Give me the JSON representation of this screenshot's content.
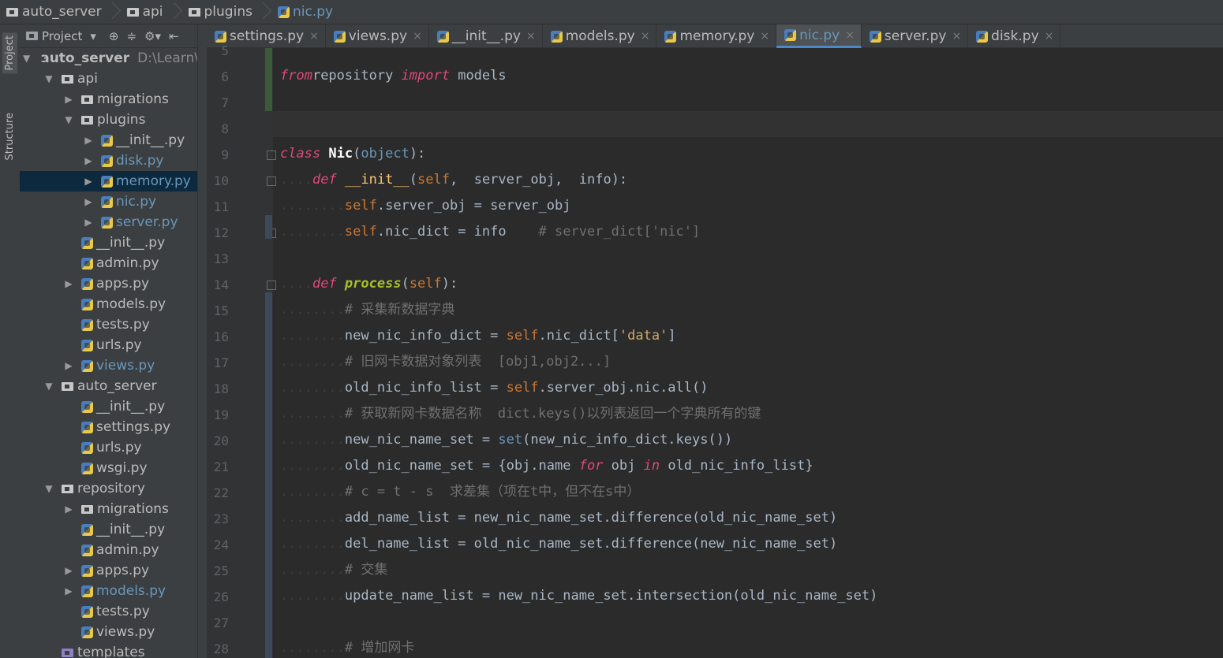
{
  "breadcrumb": [
    "auto_server",
    "api",
    "plugins",
    "nic.py"
  ],
  "project_panel": {
    "title": "Project",
    "tree": [
      {
        "depth": 0,
        "arrow": "▼",
        "type": "folder",
        "label": "auto_server",
        "path": "D:\\Learn\\P",
        "bold": true
      },
      {
        "depth": 1,
        "arrow": "▼",
        "type": "folder",
        "label": "api"
      },
      {
        "depth": 2,
        "arrow": "▶",
        "type": "folder",
        "label": "migrations"
      },
      {
        "depth": 2,
        "arrow": "▼",
        "type": "folder",
        "label": "plugins"
      },
      {
        "depth": 3,
        "arrow": "▶",
        "type": "py",
        "label": "__init__.py"
      },
      {
        "depth": 3,
        "arrow": "▶",
        "type": "py",
        "label": "disk.py",
        "blue": true
      },
      {
        "depth": 3,
        "arrow": "▶",
        "type": "py",
        "label": "memory.py",
        "blue": true,
        "selected": true
      },
      {
        "depth": 3,
        "arrow": "▶",
        "type": "py",
        "label": "nic.py",
        "blue": true
      },
      {
        "depth": 3,
        "arrow": "▶",
        "type": "py",
        "label": "server.py",
        "blue": true
      },
      {
        "depth": 2,
        "arrow": "",
        "type": "py",
        "label": "__init__.py"
      },
      {
        "depth": 2,
        "arrow": "",
        "type": "py",
        "label": "admin.py"
      },
      {
        "depth": 2,
        "arrow": "▶",
        "type": "py",
        "label": "apps.py"
      },
      {
        "depth": 2,
        "arrow": "",
        "type": "py",
        "label": "models.py"
      },
      {
        "depth": 2,
        "arrow": "",
        "type": "py",
        "label": "tests.py"
      },
      {
        "depth": 2,
        "arrow": "",
        "type": "py",
        "label": "urls.py"
      },
      {
        "depth": 2,
        "arrow": "▶",
        "type": "py",
        "label": "views.py",
        "blue": true
      },
      {
        "depth": 1,
        "arrow": "▼",
        "type": "folder",
        "label": "auto_server"
      },
      {
        "depth": 2,
        "arrow": "",
        "type": "py",
        "label": "__init__.py"
      },
      {
        "depth": 2,
        "arrow": "",
        "type": "py",
        "label": "settings.py"
      },
      {
        "depth": 2,
        "arrow": "",
        "type": "py",
        "label": "urls.py"
      },
      {
        "depth": 2,
        "arrow": "",
        "type": "py",
        "label": "wsgi.py"
      },
      {
        "depth": 1,
        "arrow": "▼",
        "type": "folder",
        "label": "repository"
      },
      {
        "depth": 2,
        "arrow": "▶",
        "type": "folder",
        "label": "migrations"
      },
      {
        "depth": 2,
        "arrow": "",
        "type": "py",
        "label": "__init__.py"
      },
      {
        "depth": 2,
        "arrow": "",
        "type": "py",
        "label": "admin.py"
      },
      {
        "depth": 2,
        "arrow": "▶",
        "type": "py",
        "label": "apps.py"
      },
      {
        "depth": 2,
        "arrow": "▶",
        "type": "py",
        "label": "models.py",
        "blue": true
      },
      {
        "depth": 2,
        "arrow": "",
        "type": "py",
        "label": "tests.py"
      },
      {
        "depth": 2,
        "arrow": "",
        "type": "py",
        "label": "views.py"
      },
      {
        "depth": 1,
        "arrow": "",
        "type": "folder",
        "label": "templates"
      }
    ]
  },
  "side_tabs": [
    "Project",
    "Structure"
  ],
  "tabs": [
    {
      "label": "settings.py"
    },
    {
      "label": "views.py"
    },
    {
      "label": "__init__.py"
    },
    {
      "label": "models.py"
    },
    {
      "label": "memory.py"
    },
    {
      "label": "nic.py",
      "active": true
    },
    {
      "label": "server.py"
    },
    {
      "label": "disk.py"
    }
  ],
  "line_numbers": [
    "5",
    "6",
    "7",
    "8",
    "9",
    "10",
    "11",
    "12",
    "13",
    "14",
    "15",
    "16",
    "17",
    "18",
    "19",
    "20",
    "21",
    "22",
    "23",
    "24",
    "25",
    "26",
    "27",
    "28"
  ],
  "code_lines": [
    [],
    [
      [
        "kwp",
        "from"
      ],
      [
        "",
        "repository "
      ],
      [
        "kwp",
        "import"
      ],
      [
        "",
        " models"
      ]
    ],
    [],
    [],
    [
      [
        "kwp",
        "class "
      ],
      [
        "cls",
        "Nic"
      ],
      [
        "",
        "("
      ],
      [
        "builtin",
        "object"
      ],
      [
        "",
        "):"
      ]
    ],
    [
      [
        "dots",
        "...."
      ],
      [
        "kwp",
        "def "
      ],
      [
        "fn",
        "__init__"
      ],
      [
        "",
        "("
      ],
      [
        "self",
        "self"
      ],
      [
        "",
        ",  server_obj,  info):"
      ]
    ],
    [
      [
        "dots",
        "........"
      ],
      [
        "self",
        "self"
      ],
      [
        "",
        ".server_obj = server_obj"
      ]
    ],
    [
      [
        "dots",
        "........"
      ],
      [
        "self",
        "self"
      ],
      [
        "",
        ".nic_dict = info  "
      ],
      [
        "cmt",
        "  # server_dict['nic']"
      ]
    ],
    [],
    [
      [
        "dots",
        "...."
      ],
      [
        "kwp",
        "def "
      ],
      [
        "fnb",
        "process"
      ],
      [
        "",
        "("
      ],
      [
        "self",
        "self"
      ],
      [
        "",
        "):"
      ]
    ],
    [
      [
        "dots",
        "........"
      ],
      [
        "cmt",
        "# 采集新数据字典"
      ]
    ],
    [
      [
        "dots",
        "........"
      ],
      [
        "",
        "new_nic_info_dict = "
      ],
      [
        "self",
        "self"
      ],
      [
        "",
        ".nic_dict["
      ],
      [
        "str",
        "'data'"
      ],
      [
        "",
        "]"
      ]
    ],
    [
      [
        "dots",
        "........"
      ],
      [
        "cmt",
        "# 旧网卡数据对象列表  [obj1,obj2...]"
      ]
    ],
    [
      [
        "dots",
        "........"
      ],
      [
        "",
        "old_nic_info_list = "
      ],
      [
        "self",
        "self"
      ],
      [
        "",
        ".server_obj.nic.all()"
      ]
    ],
    [
      [
        "dots",
        "........"
      ],
      [
        "cmt",
        "# 获取新网卡数据名称  dict.keys()以列表返回一个字典所有的键"
      ]
    ],
    [
      [
        "dots",
        "........"
      ],
      [
        "",
        "new_nic_name_set = "
      ],
      [
        "builtin",
        "set"
      ],
      [
        "",
        "(new_nic_info_dict.keys())"
      ]
    ],
    [
      [
        "dots",
        "........"
      ],
      [
        "",
        "old_nic_name_set = {obj.name "
      ],
      [
        "kwp",
        "for"
      ],
      [
        "",
        " obj "
      ],
      [
        "kwp",
        "in"
      ],
      [
        "",
        " old_nic_info_list}"
      ]
    ],
    [
      [
        "dots",
        "........"
      ],
      [
        "cmt",
        "# c = t - s  求差集（项在t中，但不在s中）"
      ]
    ],
    [
      [
        "dots",
        "........"
      ],
      [
        "",
        "add_name_list = new_nic_name_set.difference(old_nic_name_set)"
      ]
    ],
    [
      [
        "dots",
        "........"
      ],
      [
        "",
        "del_name_list = old_nic_name_set.difference(new_nic_name_set)"
      ]
    ],
    [
      [
        "dots",
        "........"
      ],
      [
        "cmt",
        "# 交集"
      ]
    ],
    [
      [
        "dots",
        "........"
      ],
      [
        "",
        "update_name_list = new_nic_name_set.intersection(old_nic_name_set)"
      ]
    ],
    [],
    [
      [
        "dots",
        "........"
      ],
      [
        "cmt",
        "# 增加网卡"
      ]
    ]
  ],
  "colors": {
    "background": "#2b2b2b",
    "panel": "#3c3f41",
    "keyword": "#e0487a",
    "selection": "#0d293e",
    "active_tab_accent": "#4a88c7"
  }
}
